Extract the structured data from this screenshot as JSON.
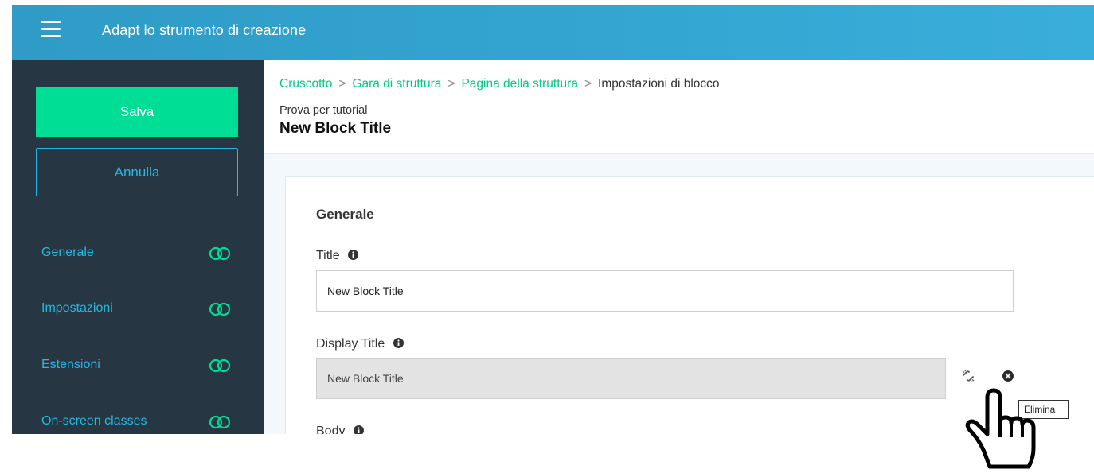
{
  "header": {
    "title": "Adapt lo strumento di creazione"
  },
  "sidebar": {
    "save_label": "Salva",
    "cancel_label": "Annulla",
    "items": [
      {
        "label": "Generale"
      },
      {
        "label": "Impostazioni"
      },
      {
        "label": "Estensioni"
      },
      {
        "label": "On-screen classes"
      }
    ]
  },
  "breadcrumb": {
    "items": [
      "Cruscotto",
      "Gara di struttura",
      "Pagina della struttura"
    ],
    "separator": ">",
    "current": "Impostazioni di blocco"
  },
  "page": {
    "subtitle": "Prova per tutorial",
    "title": "New Block Title"
  },
  "form": {
    "section_title": "Generale",
    "title_label": "Title",
    "title_value": "New Block Title",
    "display_title_label": "Display Title",
    "display_title_value": "New Block Title",
    "body_label": "Body"
  },
  "tooltip": {
    "text": "Elimina"
  },
  "colors": {
    "header": "#34a6d2",
    "sidebar": "#263642",
    "save": "#00dd95",
    "accent": "#24b9e2",
    "link": "#00c989"
  },
  "icons": {
    "menu": "hamburger-menu-icon",
    "toggle": "toggle-icon",
    "info": "info-icon",
    "unlink": "unlink-icon",
    "delete": "close-circle-icon",
    "cursor": "hand-pointer-icon"
  }
}
